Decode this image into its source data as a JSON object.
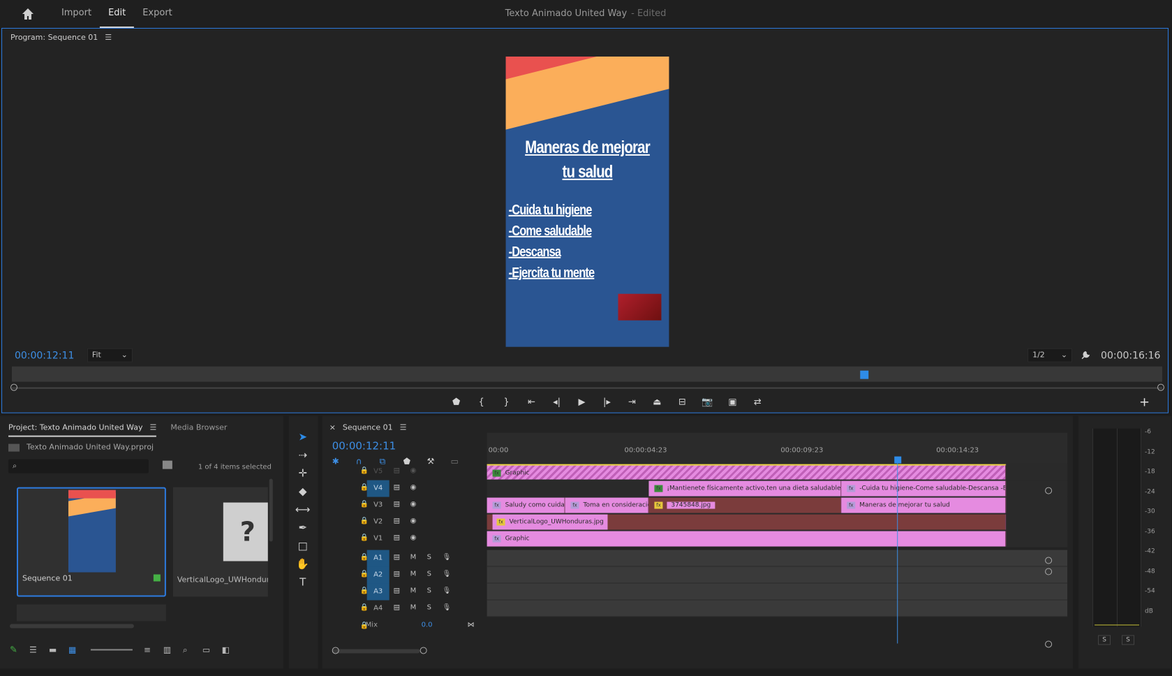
{
  "topbar": {
    "tabs": [
      {
        "label": "Import",
        "active": false
      },
      {
        "label": "Edit",
        "active": true
      },
      {
        "label": "Export",
        "active": false
      }
    ],
    "title": "Texto Animado United Way",
    "title_state": "- Edited"
  },
  "program": {
    "panel_title": "Program: Sequence 01",
    "timecode_current": "00:00:12:11",
    "timecode_duration": "00:00:16:16",
    "zoom": "Fit",
    "resolution": "1/2",
    "video": {
      "title_line1": "Maneras de mejorar",
      "title_line2": "tu salud",
      "list": [
        "-Cuida tu higiene",
        "-Come saludable",
        "-Descansa",
        "-Ejercita tu mente"
      ]
    }
  },
  "project": {
    "tabs": [
      {
        "label": "Project: Texto Animado United Way",
        "active": true
      },
      {
        "label": "Media Browser",
        "active": false
      }
    ],
    "file_name": "Texto Animado United Way.prproj",
    "selection": "1 of 4 items selected",
    "items": [
      {
        "name": "Sequence 01"
      },
      {
        "name": "VerticalLogo_UWHonduras.jpg"
      }
    ]
  },
  "timeline": {
    "tab": "Sequence 01",
    "timecode": "00:00:12:11",
    "ruler": [
      "00:00",
      "00:00:04:23",
      "00:00:09:23",
      "00:00:14:23"
    ],
    "video_tracks": [
      {
        "name": "V5",
        "clips": [
          {
            "label": "Graphic"
          }
        ]
      },
      {
        "name": "V4",
        "clips": [
          {
            "label": "¡Mantienete físicamente activo,ten una dieta saludable y siempre"
          },
          {
            "label": "-Cuida tu higiene-Come saludable-Descansa -Ejercita t"
          }
        ]
      },
      {
        "name": "V3",
        "clips": [
          {
            "label": "Saludy como cuidarla"
          },
          {
            "label": "Toma en consideraciónt"
          },
          {
            "label": "3745848.jpg"
          },
          {
            "label": "Maneras de mejorar tu salud"
          }
        ]
      },
      {
        "name": "V2",
        "clips": [
          {
            "label": "VerticalLogo_UWHonduras.jpg"
          }
        ]
      },
      {
        "name": "V1",
        "clips": [
          {
            "label": "Graphic"
          }
        ]
      }
    ],
    "audio_tracks": [
      {
        "name": "A1"
      },
      {
        "name": "A2"
      },
      {
        "name": "A3"
      },
      {
        "name": "A4"
      }
    ],
    "mix_label": "Mix",
    "mix_value": "0.0",
    "m_label": "M",
    "s_label": "S"
  },
  "meter": {
    "scale": [
      "-6",
      "-12",
      "-18",
      "-24",
      "-30",
      "-36",
      "-42",
      "-48",
      "-54",
      "dB"
    ],
    "solo_left": "S",
    "solo_right": "S"
  }
}
